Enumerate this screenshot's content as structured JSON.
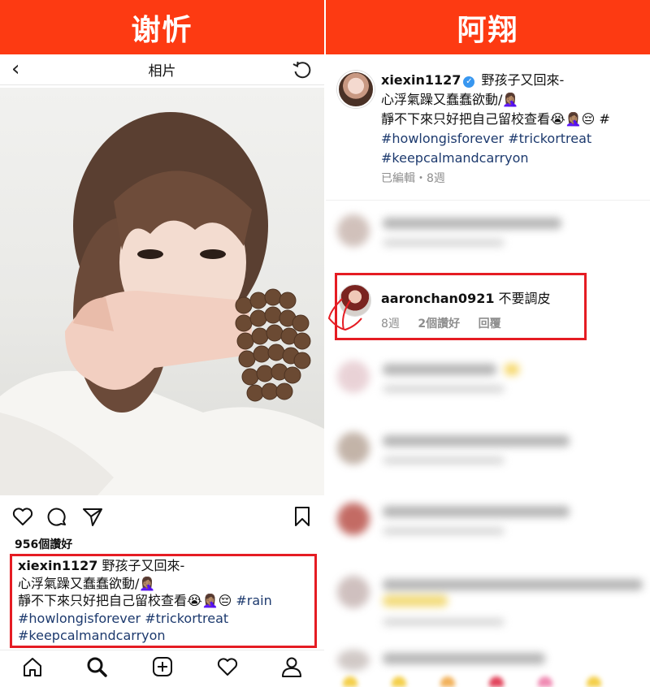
{
  "left_panel": {
    "banner": "谢忻",
    "topbar": {
      "back_glyph": "‹",
      "title": "相片"
    },
    "likes": "956個讚好",
    "caption": {
      "username": "xiexin1127",
      "line1_text": " 野孩子又回來-",
      "line2": "心浮氣躁又蠢蠢欲動/🤦🏽‍♀️",
      "line3_text": "靜不下來只好把自己留校查看😭🤦🏽‍♀️😔 ",
      "line3_tag": "#rain",
      "line4": "#howlongisforever #trickortreat",
      "line5": "#keepcalmandcarryon"
    },
    "icons": {
      "top": [
        "back-icon",
        "refresh-icon"
      ],
      "actions": [
        "heart-icon",
        "comment-icon",
        "share-icon",
        "bookmark-icon"
      ],
      "nav": [
        "home-icon",
        "search-icon",
        "add-post-icon",
        "activity-icon",
        "profile-icon"
      ]
    }
  },
  "right_panel": {
    "banner": "阿翔",
    "post": {
      "username": "xiexin1127",
      "verified_glyph": "✓",
      "line1_text": " 野孩子又回來-",
      "line2": "心浮氣躁又蠢蠢欲動/🤦🏽‍♀️",
      "line3": "靜不下來只好把自己留校查看😭🤦🏽‍♀️😔 #",
      "line4": "#howlongisforever #trickortreat",
      "line5": "#keepcalmandcarryon",
      "meta": "已編輯・8週"
    },
    "highlighted_comment": {
      "username": "aaronchan0921",
      "text": " 不要調皮",
      "time": "8週",
      "likes": "2個讚好",
      "reply": "回覆"
    }
  },
  "colors": {
    "banner_bg": "#fd3a12",
    "highlight_border": "#e51c23",
    "hashtag": "#1d3a6e",
    "verified": "#3897f0"
  }
}
